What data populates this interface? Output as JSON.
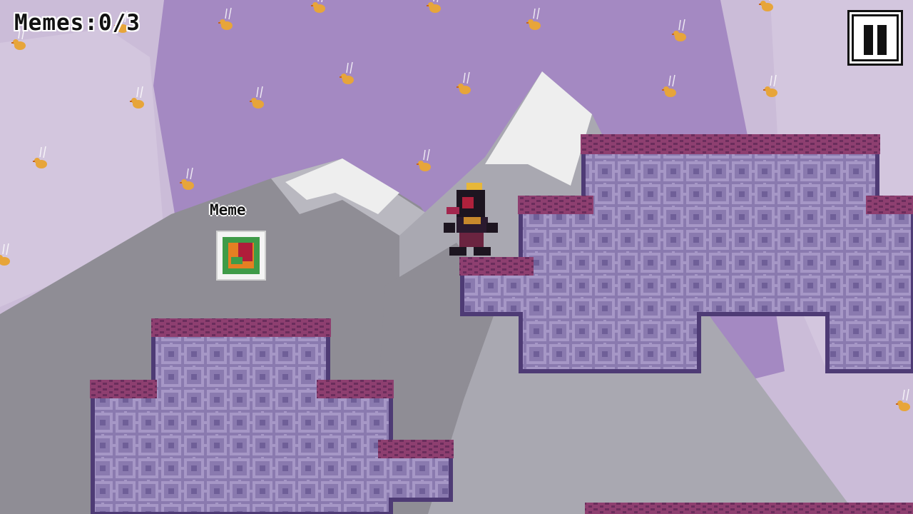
{
  "hud": {
    "memes_label": "Memes:",
    "memes_count": "0/3"
  },
  "pickup": {
    "label": "Meme"
  },
  "colors": {
    "sky": "#a489c2",
    "haze": "#cbbcd8",
    "mountain_dark": "#8f8d95",
    "mountain_light": "#b9b8c0",
    "snow": "#eeeeee",
    "platform_top": "#8e3f70",
    "platform_body": "#8a7aaf",
    "platform_edge": "#4e3b75",
    "duck": "#e7a53a"
  },
  "icons": {
    "pause": "pause-icon",
    "player": "player-character",
    "collectible": "meme-frame-icon",
    "hazard": "falling-duck-icon"
  }
}
